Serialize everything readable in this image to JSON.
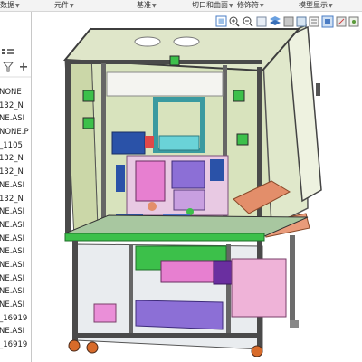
{
  "ribbon": {
    "groups": [
      {
        "label": "数据"
      },
      {
        "label": "元件"
      },
      {
        "label": "基准"
      },
      {
        "label": "切口和曲面"
      },
      {
        "label": "修饰符"
      },
      {
        "label": "模型显示"
      }
    ],
    "dropdown_glyph": "▼"
  },
  "left_panel": {
    "tree_items": [
      "NONE",
      "132_N",
      "NE.ASI",
      "NONE.P",
      "_1105",
      "132_N",
      "132_N",
      "NE.ASI",
      "132_N",
      "NE.ASI",
      "NE.ASI",
      "NE.ASI",
      "NE.ASI",
      "NE.ASI",
      "NE.ASI",
      "NE.ASI",
      "NE.ASI",
      "_16919",
      "NE.ASI",
      "_16919"
    ],
    "icons": [
      "list-icon",
      "filter-icon",
      "add-icon"
    ]
  },
  "view_toolbar": {
    "icons": [
      "refit-icon",
      "zoom-in-icon",
      "zoom-out-icon",
      "repaint-icon",
      "layer-icon",
      "display-style-icon",
      "view-manager-icon",
      "saved-views-icon",
      "annotation-icon",
      "datum-display-icon",
      "spin-center-icon"
    ]
  },
  "colors": {
    "frame_dark": "#4a4a4a",
    "frame_light": "#8a8f8f",
    "glass": "#c9d9a8",
    "base_green": "#3cc04a",
    "panel_cyan": "#6ad3d8",
    "part_pink": "#e77fd0",
    "part_purple": "#8c6fd6",
    "part_blue": "#2a52a8",
    "part_orange": "#e38e6a",
    "caster_orange": "#d86b2a"
  }
}
